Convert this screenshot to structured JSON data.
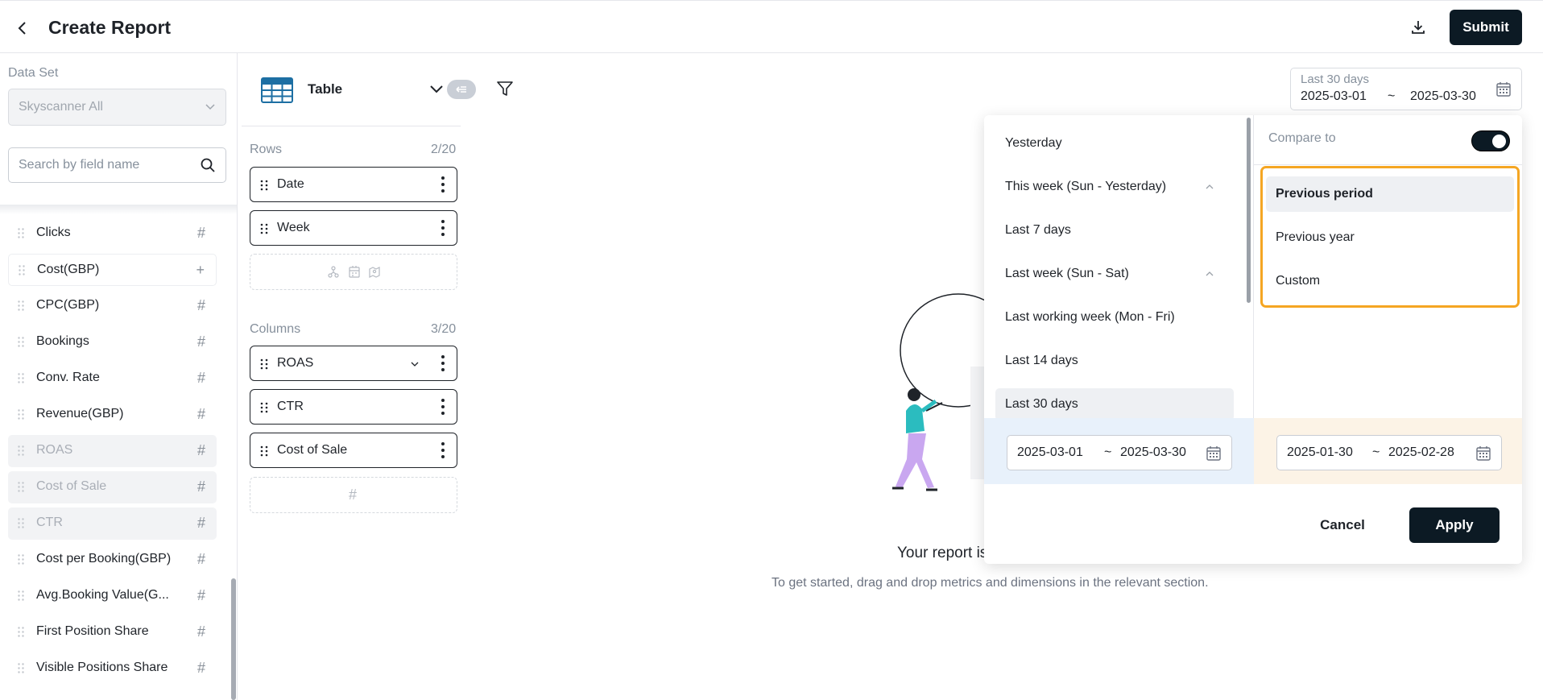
{
  "header": {
    "title": "Create Report",
    "submit_label": "Submit"
  },
  "sidebar": {
    "dataset_label": "Data Set",
    "dataset_value": "Skyscanner All",
    "search_placeholder": "Search by field name",
    "fields": [
      {
        "label": "Clicks",
        "type": "#"
      },
      {
        "label": "Cost(GBP)",
        "type": "+"
      },
      {
        "label": "CPC(GBP)",
        "type": "#"
      },
      {
        "label": "Bookings",
        "type": "#"
      },
      {
        "label": "Conv. Rate",
        "type": "#"
      },
      {
        "label": "Revenue(GBP)",
        "type": "#"
      },
      {
        "label": "ROAS",
        "type": "#"
      },
      {
        "label": "Cost of Sale",
        "type": "#"
      },
      {
        "label": "CTR",
        "type": "#"
      },
      {
        "label": "Cost per Booking(GBP)",
        "type": "#"
      },
      {
        "label": "Avg.Booking Value(G...",
        "type": "#"
      },
      {
        "label": "First Position Share",
        "type": "#"
      },
      {
        "label": "Visible Positions Share",
        "type": "#"
      }
    ]
  },
  "config": {
    "viz_type": "Table",
    "rows_label": "Rows",
    "rows_count": "2/20",
    "rows": [
      "Date",
      "Week"
    ],
    "columns_label": "Columns",
    "columns_count": "3/20",
    "columns": [
      "ROAS",
      "CTR",
      "Cost of Sale"
    ],
    "dropzone_symbol": "#"
  },
  "empty_state": {
    "title": "Your report is",
    "subtitle": "To get started, drag and drop metrics and dimensions in the relevant section."
  },
  "date_trigger": {
    "label": "Last 30 days",
    "start": "2025-03-01",
    "tilde": "~",
    "end": "2025-03-30"
  },
  "picker": {
    "presets": [
      {
        "label": "Yesterday",
        "chevron": false
      },
      {
        "label": "This week (Sun - Yesterday)",
        "chevron": true
      },
      {
        "label": "Last 7 days",
        "chevron": false
      },
      {
        "label": "Last week (Sun - Sat)",
        "chevron": true
      },
      {
        "label": "Last working week (Mon - Fri)",
        "chevron": false
      },
      {
        "label": "Last 14 days",
        "chevron": false
      },
      {
        "label": "Last 30 days",
        "chevron": false
      }
    ],
    "active_preset": "Last 30 days",
    "compare_label": "Compare to",
    "compare_enabled": true,
    "compare_options": [
      "Previous period",
      "Previous year",
      "Custom"
    ],
    "active_compare": "Previous period",
    "range": {
      "start": "2025-03-01",
      "end": "2025-03-30"
    },
    "compare_range": {
      "start": "2025-01-30",
      "end": "2025-02-28"
    },
    "tilde": "~",
    "cancel_label": "Cancel",
    "apply_label": "Apply"
  },
  "colors": {
    "primary_button": "#0c1a24",
    "highlight_border": "#f5a623",
    "range_bg": "#e8f1fb",
    "compare_range_bg": "#fcf3e6",
    "table_icon": "#1d6fa3"
  }
}
